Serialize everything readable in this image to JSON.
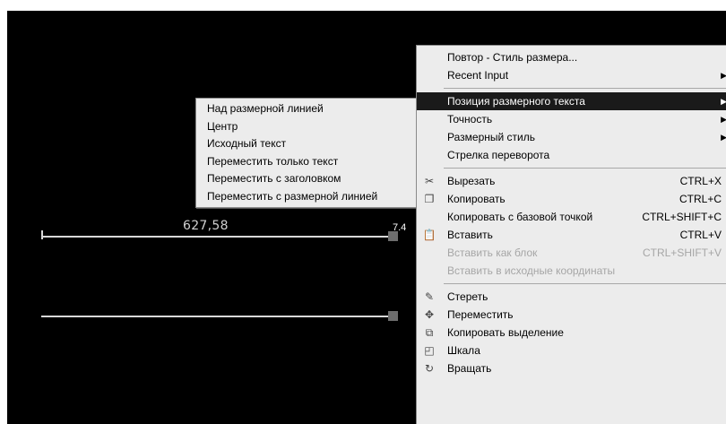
{
  "drawing": {
    "dimension_value": "627,58",
    "mark": "7.4"
  },
  "context_menu": {
    "items_top": [
      {
        "label": "Повтор - Стиль размера..."
      },
      {
        "label": "Recent Input",
        "arrow": "▶"
      }
    ],
    "items_mid": [
      {
        "label": "Позиция размерного текста",
        "arrow": "▶"
      },
      {
        "label": "Точность",
        "arrow": "▶"
      },
      {
        "label": "Размерный стиль",
        "arrow": "▶"
      },
      {
        "label": "Стрелка переворота"
      }
    ],
    "items_clip": [
      {
        "label": "Вырезать",
        "shortcut": "CTRL+X",
        "icon": "scissors-icon",
        "glyph": "✂"
      },
      {
        "label": "Копировать",
        "shortcut": "CTRL+C",
        "icon": "copy-icon",
        "glyph": "❐"
      },
      {
        "label": "Копировать с базовой точкой",
        "shortcut": "CTRL+SHIFT+C"
      },
      {
        "label": "Вставить",
        "shortcut": "CTRL+V",
        "icon": "paste-icon",
        "glyph": "📋"
      },
      {
        "label": "Вставить как блок",
        "shortcut": "CTRL+SHIFT+V"
      },
      {
        "label": "Вставить в исходные координаты"
      }
    ],
    "items_edit": [
      {
        "label": "Стереть",
        "icon": "eraser-icon",
        "glyph": "✎"
      },
      {
        "label": "Переместить",
        "icon": "move-icon",
        "glyph": "✥"
      },
      {
        "label": "Копировать выделение",
        "icon": "copy-selection-icon",
        "glyph": "⧉"
      },
      {
        "label": "Шкала",
        "icon": "scale-icon",
        "glyph": "◰"
      },
      {
        "label": "Вращать",
        "icon": "rotate-icon",
        "glyph": "↻"
      }
    ]
  },
  "submenu": {
    "items": [
      {
        "label": "Над размерной линией"
      },
      {
        "label": "Центр"
      },
      {
        "label": "Исходный текст"
      },
      {
        "label": "Переместить только текст"
      },
      {
        "label": "Переместить с заголовком"
      },
      {
        "label": "Переместить с размерной линией"
      }
    ]
  },
  "colors": {
    "background": "#000000",
    "menu_bg": "#ececec",
    "highlight": "#1a1a1a",
    "disabled_text": "#a6a6a6"
  }
}
